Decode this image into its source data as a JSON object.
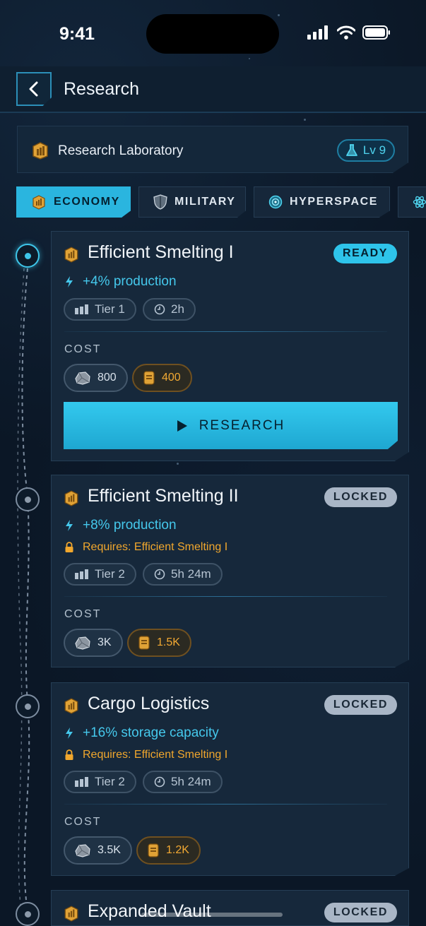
{
  "status_bar": {
    "time": "9:41"
  },
  "header": {
    "title": "Research"
  },
  "lab": {
    "title": "Research Laboratory",
    "level": "Lv 9"
  },
  "tabs": [
    {
      "label": "ECONOMY",
      "active": true
    },
    {
      "label": "MILITARY",
      "active": false
    },
    {
      "label": "HYPERSPACE",
      "active": false
    }
  ],
  "cost_label": "COST",
  "research_button": "RESEARCH",
  "cards": [
    {
      "title": "Efficient Smelting I",
      "status": "READY",
      "effect": "+4% production",
      "tier": "Tier 1",
      "time": "2h",
      "ore": "800",
      "gold": "400"
    },
    {
      "title": "Efficient Smelting II",
      "status": "LOCKED",
      "effect": "+8% production",
      "requires": "Requires: Efficient Smelting I",
      "tier": "Tier 2",
      "time": "5h 24m",
      "ore": "3K",
      "gold": "1.5K"
    },
    {
      "title": "Cargo Logistics",
      "status": "LOCKED",
      "effect": "+16% storage capacity",
      "requires": "Requires: Efficient Smelting I",
      "tier": "Tier 2",
      "time": "5h 24m",
      "ore": "3.5K",
      "gold": "1.2K"
    },
    {
      "title": "Expanded Vault",
      "status": "LOCKED"
    }
  ],
  "colors": {
    "accent": "#2ec4ea",
    "gold": "#f2a933",
    "background": "#0b1726"
  }
}
